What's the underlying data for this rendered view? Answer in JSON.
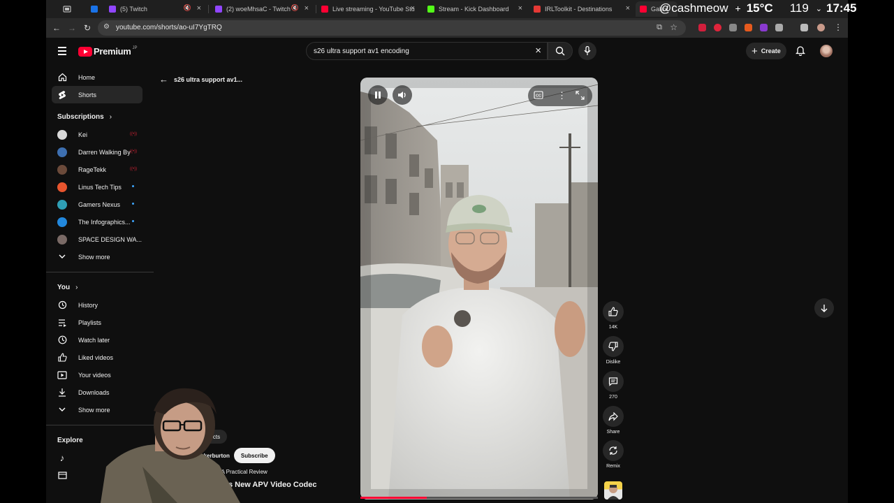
{
  "browser": {
    "tabs": [
      {
        "title": "",
        "color": "#1a73e8"
      },
      {
        "title": "(5) Twitch",
        "color": "#9146ff"
      },
      {
        "title": "(2) woeMhsaC - Twitch",
        "color": "#9146ff"
      },
      {
        "title": "Live streaming - YouTube Stu",
        "color": "#ff0033"
      },
      {
        "title": "Stream - Kick Dashboard",
        "color": "#53fc18"
      },
      {
        "title": "IRLToolkit - Destinations",
        "color": "#e53935"
      },
      {
        "title": "Galax",
        "color": "#ff0033"
      }
    ],
    "url": "youtube.com/shorts/ao-uI7YgTRQ"
  },
  "os_overlay": {
    "handle": "@cashmeow",
    "temperature": "15°C",
    "count": "119",
    "time": "17:45"
  },
  "header": {
    "logo_text": "Premium",
    "region": "JP",
    "search_query": "s26 ultra support av1 encoding",
    "create_label": "Create"
  },
  "sidebar": {
    "home": "Home",
    "shorts": "Shorts",
    "subscriptions_heading": "Subscriptions",
    "subscriptions": [
      {
        "name": "Kei",
        "status": "live",
        "color": "#d8d8d8"
      },
      {
        "name": "Darren Walking By",
        "status": "live",
        "color": "#3d6fb0"
      },
      {
        "name": "RageTekk",
        "status": "live",
        "color": "#6b4a3a"
      },
      {
        "name": "Linus Tech Tips",
        "status": "new",
        "color": "#e8552e"
      },
      {
        "name": "Gamers Nexus",
        "status": "new",
        "color": "#2f9fb5"
      },
      {
        "name": "The Infographics...",
        "status": "new",
        "color": "#2288dd"
      },
      {
        "name": "SPACE DESIGN WA...",
        "status": "",
        "color": "#7a6a66"
      }
    ],
    "show_more": "Show more",
    "you_heading": "You",
    "you_items": [
      "History",
      "Playlists",
      "Watch later",
      "Liked videos",
      "Your videos",
      "Downloads"
    ],
    "show_more_2": "Show more",
    "explore_heading": "Explore"
  },
  "shorts": {
    "back_title": "s26 ultra support av1...",
    "likes": "14K",
    "dislike": "Dislike",
    "comments": "270",
    "share": "Share",
    "remix": "Remix",
    "view_products": "View products",
    "channel": "@imparkerburton",
    "subscribe": "Subscribe",
    "related": "Z TriFold: A Practical Review",
    "title": "26 Ultra's New APV Video Codec",
    "progress": 0.28
  }
}
